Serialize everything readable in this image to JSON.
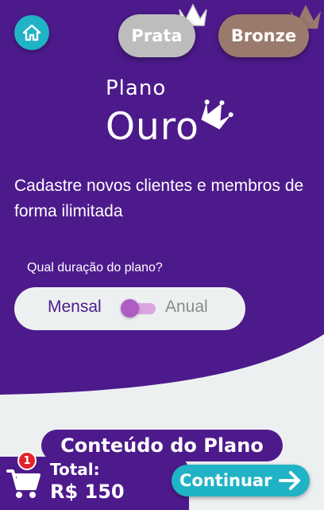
{
  "colors": {
    "primary": "#4d1a8c",
    "accent": "#1fb3c5",
    "background": "#edf0f1",
    "silver": "#bdbdbd",
    "bronze": "#9a7a6c",
    "badge": "#e0262c"
  },
  "nav": {
    "home_icon": "home-icon",
    "plans": [
      {
        "label": "Prata"
      },
      {
        "label": "Bronze"
      }
    ]
  },
  "plan": {
    "title_small": "Plano",
    "title_big": "Ouro",
    "description": "Cadastre novos clientes e membros de forma ilimitada"
  },
  "duration": {
    "label": "Qual duração do plano?",
    "option_monthly": "Mensal",
    "option_annual": "Anual",
    "selected": "Mensal"
  },
  "footer": {
    "content_button": "Conteúdo do Plano",
    "cart_icon": "cart-icon",
    "cart_count": "1",
    "total_label": "Total:",
    "total_value": "R$ 150",
    "continue_label": "Continuar"
  }
}
